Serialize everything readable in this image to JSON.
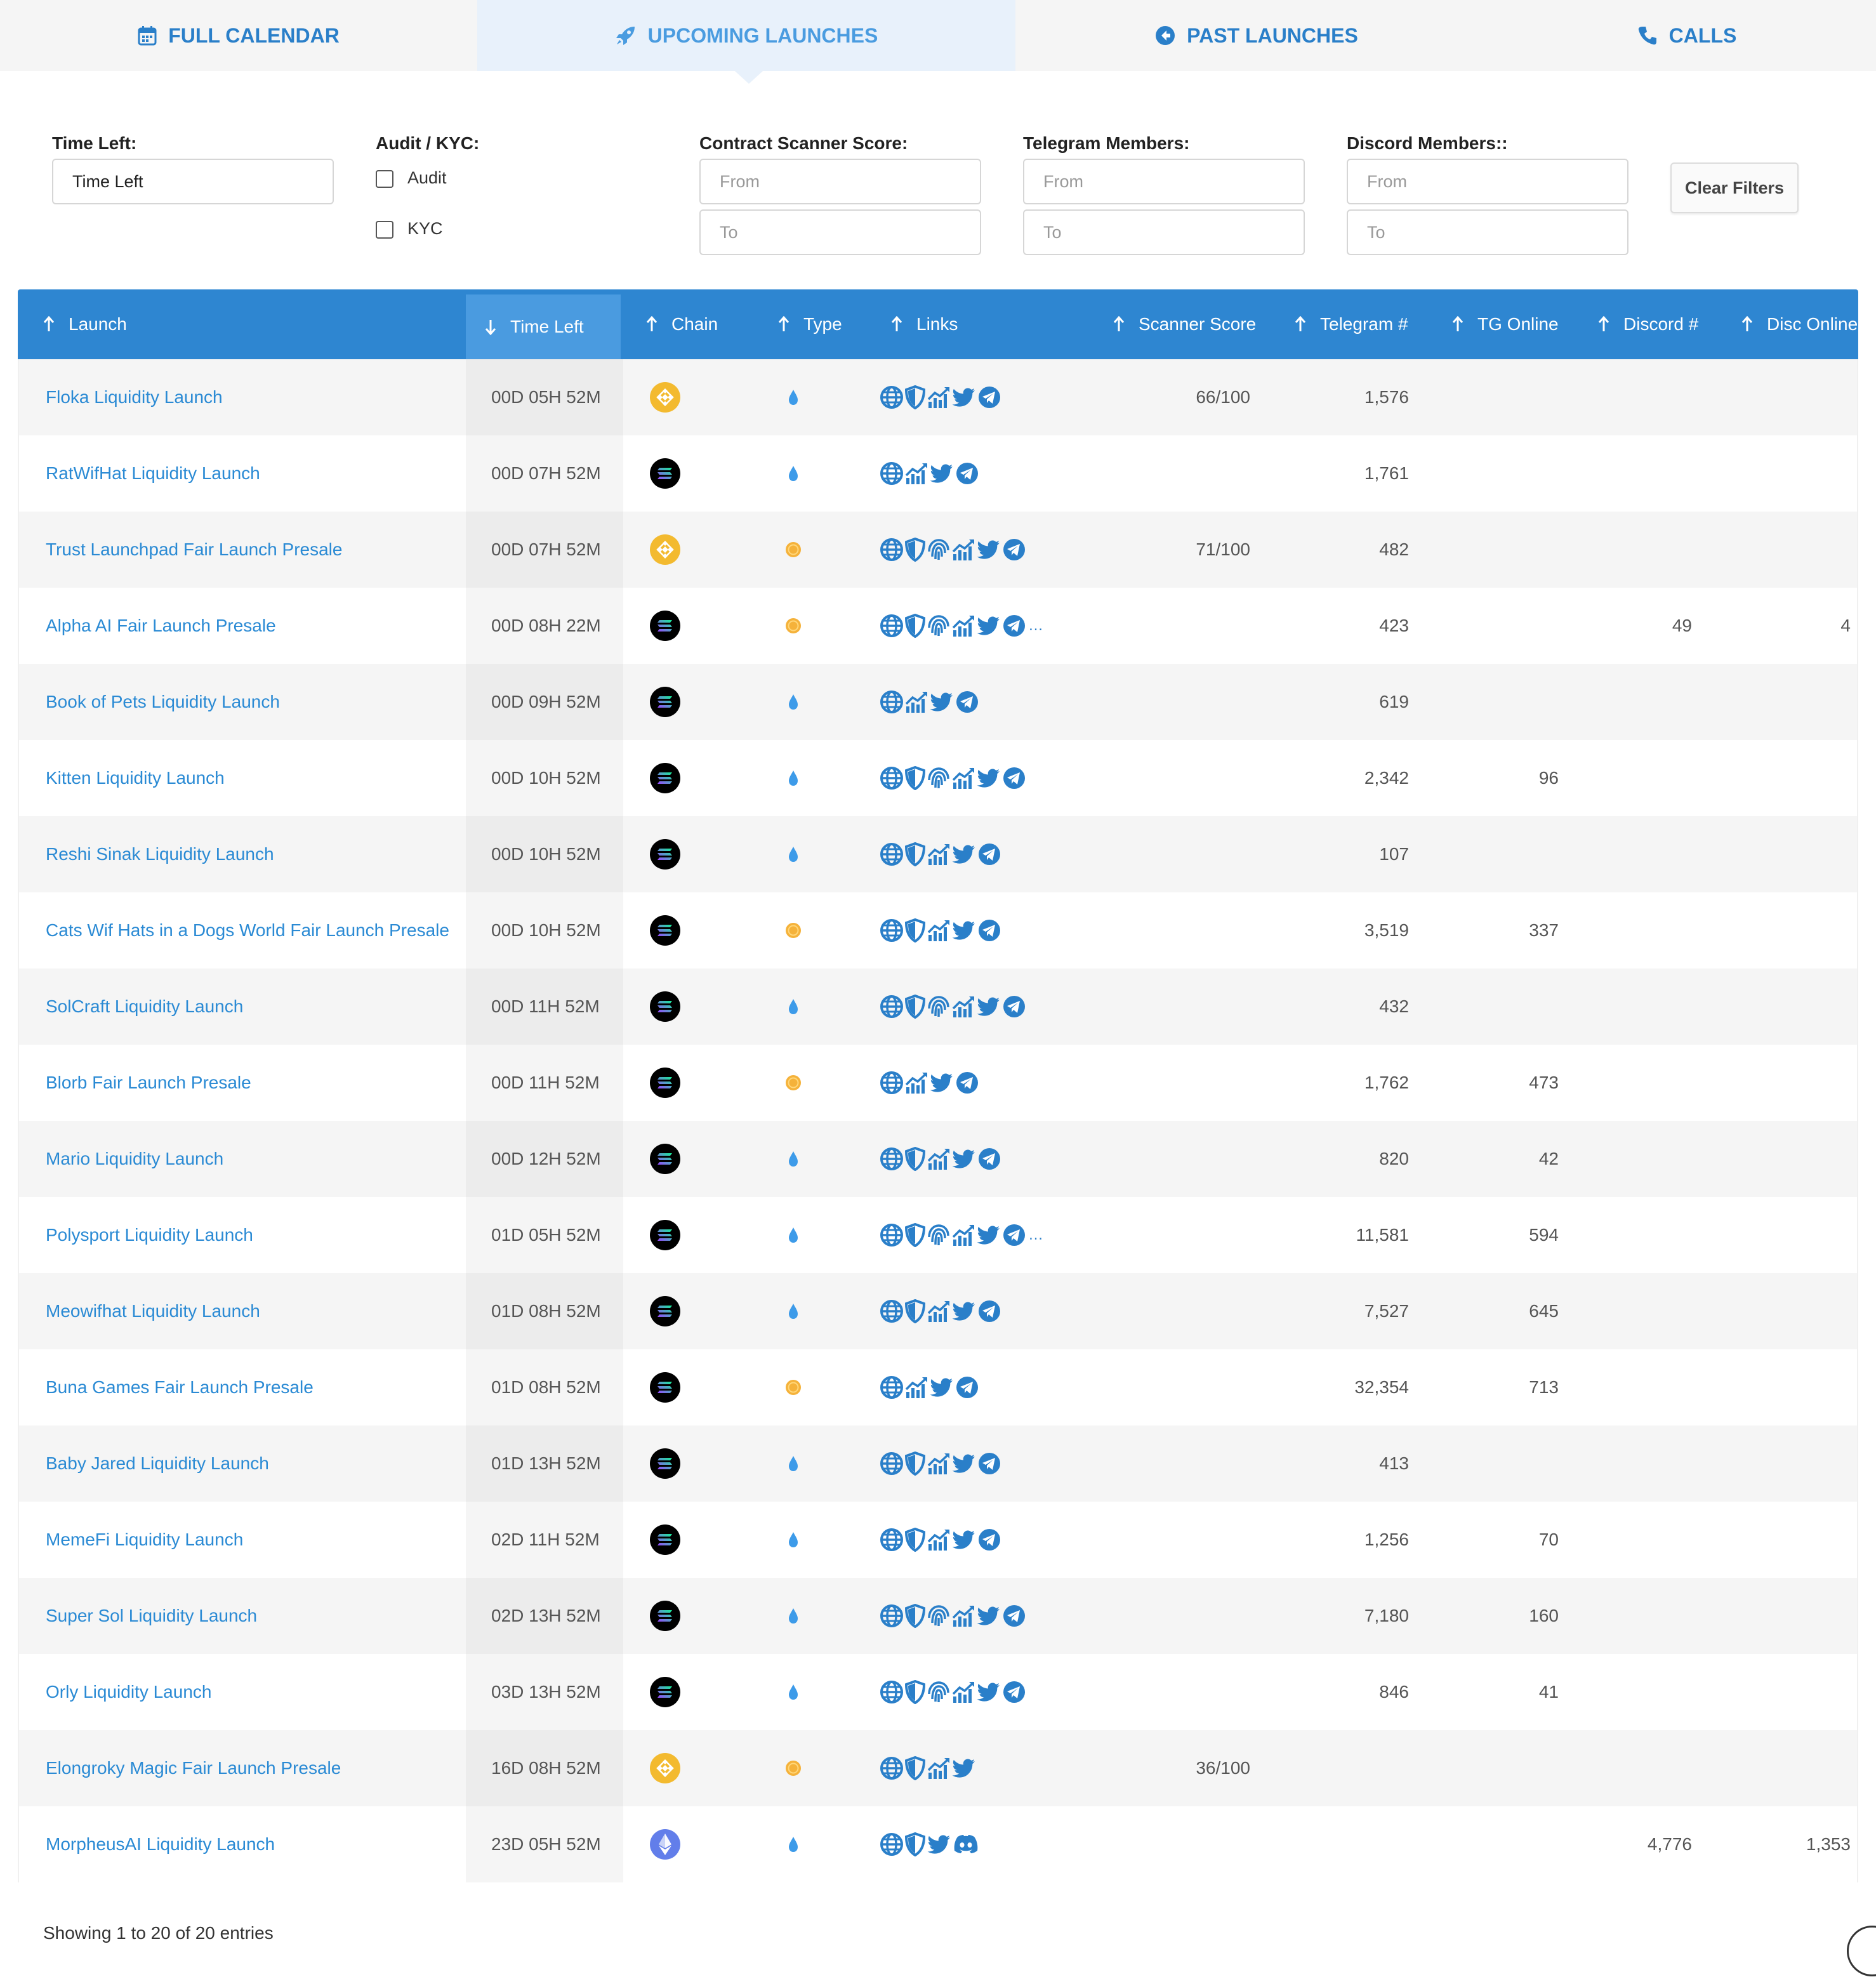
{
  "tabs": [
    {
      "label": "FULL CALENDAR",
      "icon": "calendar-icon"
    },
    {
      "label": "UPCOMING LAUNCHES",
      "icon": "rocket-icon"
    },
    {
      "label": "PAST LAUNCHES",
      "icon": "arrow-left-circle-icon"
    },
    {
      "label": "CALLS",
      "icon": "phone-icon"
    }
  ],
  "active_tab": "UPCOMING LAUNCHES",
  "filters": {
    "time_left_label": "Time Left:",
    "time_left_value": "Time Left",
    "audit_kyc_label": "Audit / KYC:",
    "audit_label": "Audit",
    "kyc_label": "KYC",
    "scanner_label": "Contract Scanner Score:",
    "telegram_label": "Telegram Members:",
    "discord_label": "Discord Members::",
    "from_placeholder": "From",
    "to_placeholder": "To",
    "clear_label": "Clear Filters"
  },
  "columns": [
    "Launch",
    "Time Left",
    "Chain",
    "Type",
    "Links",
    "Scanner Score",
    "Telegram #",
    "TG Online",
    "Discord #",
    "Disc Online"
  ],
  "colors": {
    "header_bg": "#2e86d1",
    "link": "#2a8ad4",
    "bsc": "#f3ba2f",
    "sol": "#000000",
    "eth": "#627eea",
    "liquidity_drop": "#3d9be9",
    "fair_coin": "#f5b23a"
  },
  "rows": [
    {
      "launch": "Floka Liquidity Launch",
      "time": "00D 05H 52M",
      "chain": "bsc",
      "type": "liquidity",
      "links": [
        "web",
        "shield",
        "chart",
        "twitter",
        "telegram"
      ],
      "more": false,
      "score": "66/100",
      "telegram": "1,576",
      "tg_online": "",
      "discord": "",
      "disc_online": ""
    },
    {
      "launch": "RatWifHat Liquidity Launch",
      "time": "00D 07H 52M",
      "chain": "sol",
      "type": "liquidity",
      "links": [
        "web",
        "chart",
        "twitter",
        "telegram"
      ],
      "more": false,
      "score": "",
      "telegram": "1,761",
      "tg_online": "",
      "discord": "",
      "disc_online": ""
    },
    {
      "launch": "Trust Launchpad Fair Launch Presale",
      "time": "00D 07H 52M",
      "chain": "bsc",
      "type": "fair",
      "links": [
        "web",
        "shield",
        "fingerprint",
        "chart",
        "twitter",
        "telegram"
      ],
      "more": false,
      "score": "71/100",
      "telegram": "482",
      "tg_online": "",
      "discord": "",
      "disc_online": ""
    },
    {
      "launch": "Alpha AI Fair Launch Presale",
      "time": "00D 08H 22M",
      "chain": "sol",
      "type": "fair",
      "links": [
        "web",
        "shield",
        "fingerprint",
        "chart",
        "twitter",
        "telegram"
      ],
      "more": true,
      "score": "",
      "telegram": "423",
      "tg_online": "",
      "discord": "49",
      "disc_online": "4"
    },
    {
      "launch": "Book of Pets Liquidity Launch",
      "time": "00D 09H 52M",
      "chain": "sol",
      "type": "liquidity",
      "links": [
        "web",
        "chart",
        "twitter",
        "telegram"
      ],
      "more": false,
      "score": "",
      "telegram": "619",
      "tg_online": "",
      "discord": "",
      "disc_online": ""
    },
    {
      "launch": "Kitten Liquidity Launch",
      "time": "00D 10H 52M",
      "chain": "sol",
      "type": "liquidity",
      "links": [
        "web",
        "shield",
        "fingerprint",
        "chart",
        "twitter",
        "telegram"
      ],
      "more": false,
      "score": "",
      "telegram": "2,342",
      "tg_online": "96",
      "discord": "",
      "disc_online": ""
    },
    {
      "launch": "Reshi Sinak Liquidity Launch",
      "time": "00D 10H 52M",
      "chain": "sol",
      "type": "liquidity",
      "links": [
        "web",
        "shield",
        "chart",
        "twitter",
        "telegram"
      ],
      "more": false,
      "score": "",
      "telegram": "107",
      "tg_online": "",
      "discord": "",
      "disc_online": ""
    },
    {
      "launch": "Cats Wif Hats in a Dogs World Fair Launch Presale",
      "time": "00D 10H 52M",
      "chain": "sol",
      "type": "fair",
      "links": [
        "web",
        "shield",
        "chart",
        "twitter",
        "telegram"
      ],
      "more": false,
      "score": "",
      "telegram": "3,519",
      "tg_online": "337",
      "discord": "",
      "disc_online": ""
    },
    {
      "launch": "SolCraft Liquidity Launch",
      "time": "00D 11H 52M",
      "chain": "sol",
      "type": "liquidity",
      "links": [
        "web",
        "shield",
        "fingerprint",
        "chart",
        "twitter",
        "telegram"
      ],
      "more": false,
      "score": "",
      "telegram": "432",
      "tg_online": "",
      "discord": "",
      "disc_online": ""
    },
    {
      "launch": "Blorb Fair Launch Presale",
      "time": "00D 11H 52M",
      "chain": "sol",
      "type": "fair",
      "links": [
        "web",
        "chart",
        "twitter",
        "telegram"
      ],
      "more": false,
      "score": "",
      "telegram": "1,762",
      "tg_online": "473",
      "discord": "",
      "disc_online": ""
    },
    {
      "launch": "Mario Liquidity Launch",
      "time": "00D 12H 52M",
      "chain": "sol",
      "type": "liquidity",
      "links": [
        "web",
        "shield",
        "chart",
        "twitter",
        "telegram"
      ],
      "more": false,
      "score": "",
      "telegram": "820",
      "tg_online": "42",
      "discord": "",
      "disc_online": ""
    },
    {
      "launch": "Polysport Liquidity Launch",
      "time": "01D 05H 52M",
      "chain": "sol",
      "type": "liquidity",
      "links": [
        "web",
        "shield",
        "fingerprint",
        "chart",
        "twitter",
        "telegram"
      ],
      "more": true,
      "score": "",
      "telegram": "11,581",
      "tg_online": "594",
      "discord": "",
      "disc_online": ""
    },
    {
      "launch": "Meowifhat Liquidity Launch",
      "time": "01D 08H 52M",
      "chain": "sol",
      "type": "liquidity",
      "links": [
        "web",
        "shield",
        "chart",
        "twitter",
        "telegram"
      ],
      "more": false,
      "score": "",
      "telegram": "7,527",
      "tg_online": "645",
      "discord": "",
      "disc_online": ""
    },
    {
      "launch": "Buna Games Fair Launch Presale",
      "time": "01D 08H 52M",
      "chain": "sol",
      "type": "fair",
      "links": [
        "web",
        "chart",
        "twitter",
        "telegram"
      ],
      "more": false,
      "score": "",
      "telegram": "32,354",
      "tg_online": "713",
      "discord": "",
      "disc_online": ""
    },
    {
      "launch": "Baby Jared Liquidity Launch",
      "time": "01D 13H 52M",
      "chain": "sol",
      "type": "liquidity",
      "links": [
        "web",
        "shield",
        "chart",
        "twitter",
        "telegram"
      ],
      "more": false,
      "score": "",
      "telegram": "413",
      "tg_online": "",
      "discord": "",
      "disc_online": ""
    },
    {
      "launch": "MemeFi Liquidity Launch",
      "time": "02D 11H 52M",
      "chain": "sol",
      "type": "liquidity",
      "links": [
        "web",
        "shield",
        "chart",
        "twitter",
        "telegram"
      ],
      "more": false,
      "score": "",
      "telegram": "1,256",
      "tg_online": "70",
      "discord": "",
      "disc_online": ""
    },
    {
      "launch": "Super Sol Liquidity Launch",
      "time": "02D 13H 52M",
      "chain": "sol",
      "type": "liquidity",
      "links": [
        "web",
        "shield",
        "fingerprint",
        "chart",
        "twitter",
        "telegram"
      ],
      "more": false,
      "score": "",
      "telegram": "7,180",
      "tg_online": "160",
      "discord": "",
      "disc_online": ""
    },
    {
      "launch": "Orly Liquidity Launch",
      "time": "03D 13H 52M",
      "chain": "sol",
      "type": "liquidity",
      "links": [
        "web",
        "shield",
        "fingerprint",
        "chart",
        "twitter",
        "telegram"
      ],
      "more": false,
      "score": "",
      "telegram": "846",
      "tg_online": "41",
      "discord": "",
      "disc_online": ""
    },
    {
      "launch": "Elongroky Magic Fair Launch Presale",
      "time": "16D 08H 52M",
      "chain": "bsc",
      "type": "fair",
      "links": [
        "web",
        "shield",
        "chart",
        "twitter"
      ],
      "more": false,
      "score": "36/100",
      "telegram": "",
      "tg_online": "",
      "discord": "",
      "disc_online": ""
    },
    {
      "launch": "MorpheusAI Liquidity Launch",
      "time": "23D 05H 52M",
      "chain": "eth",
      "type": "liquidity",
      "links": [
        "web",
        "shield",
        "twitter",
        "discord"
      ],
      "more": false,
      "score": "",
      "telegram": "",
      "tg_online": "",
      "discord": "4,776",
      "disc_online": "1,353"
    }
  ],
  "footer": {
    "info": "Showing 1 to 20 of 20 entries"
  }
}
